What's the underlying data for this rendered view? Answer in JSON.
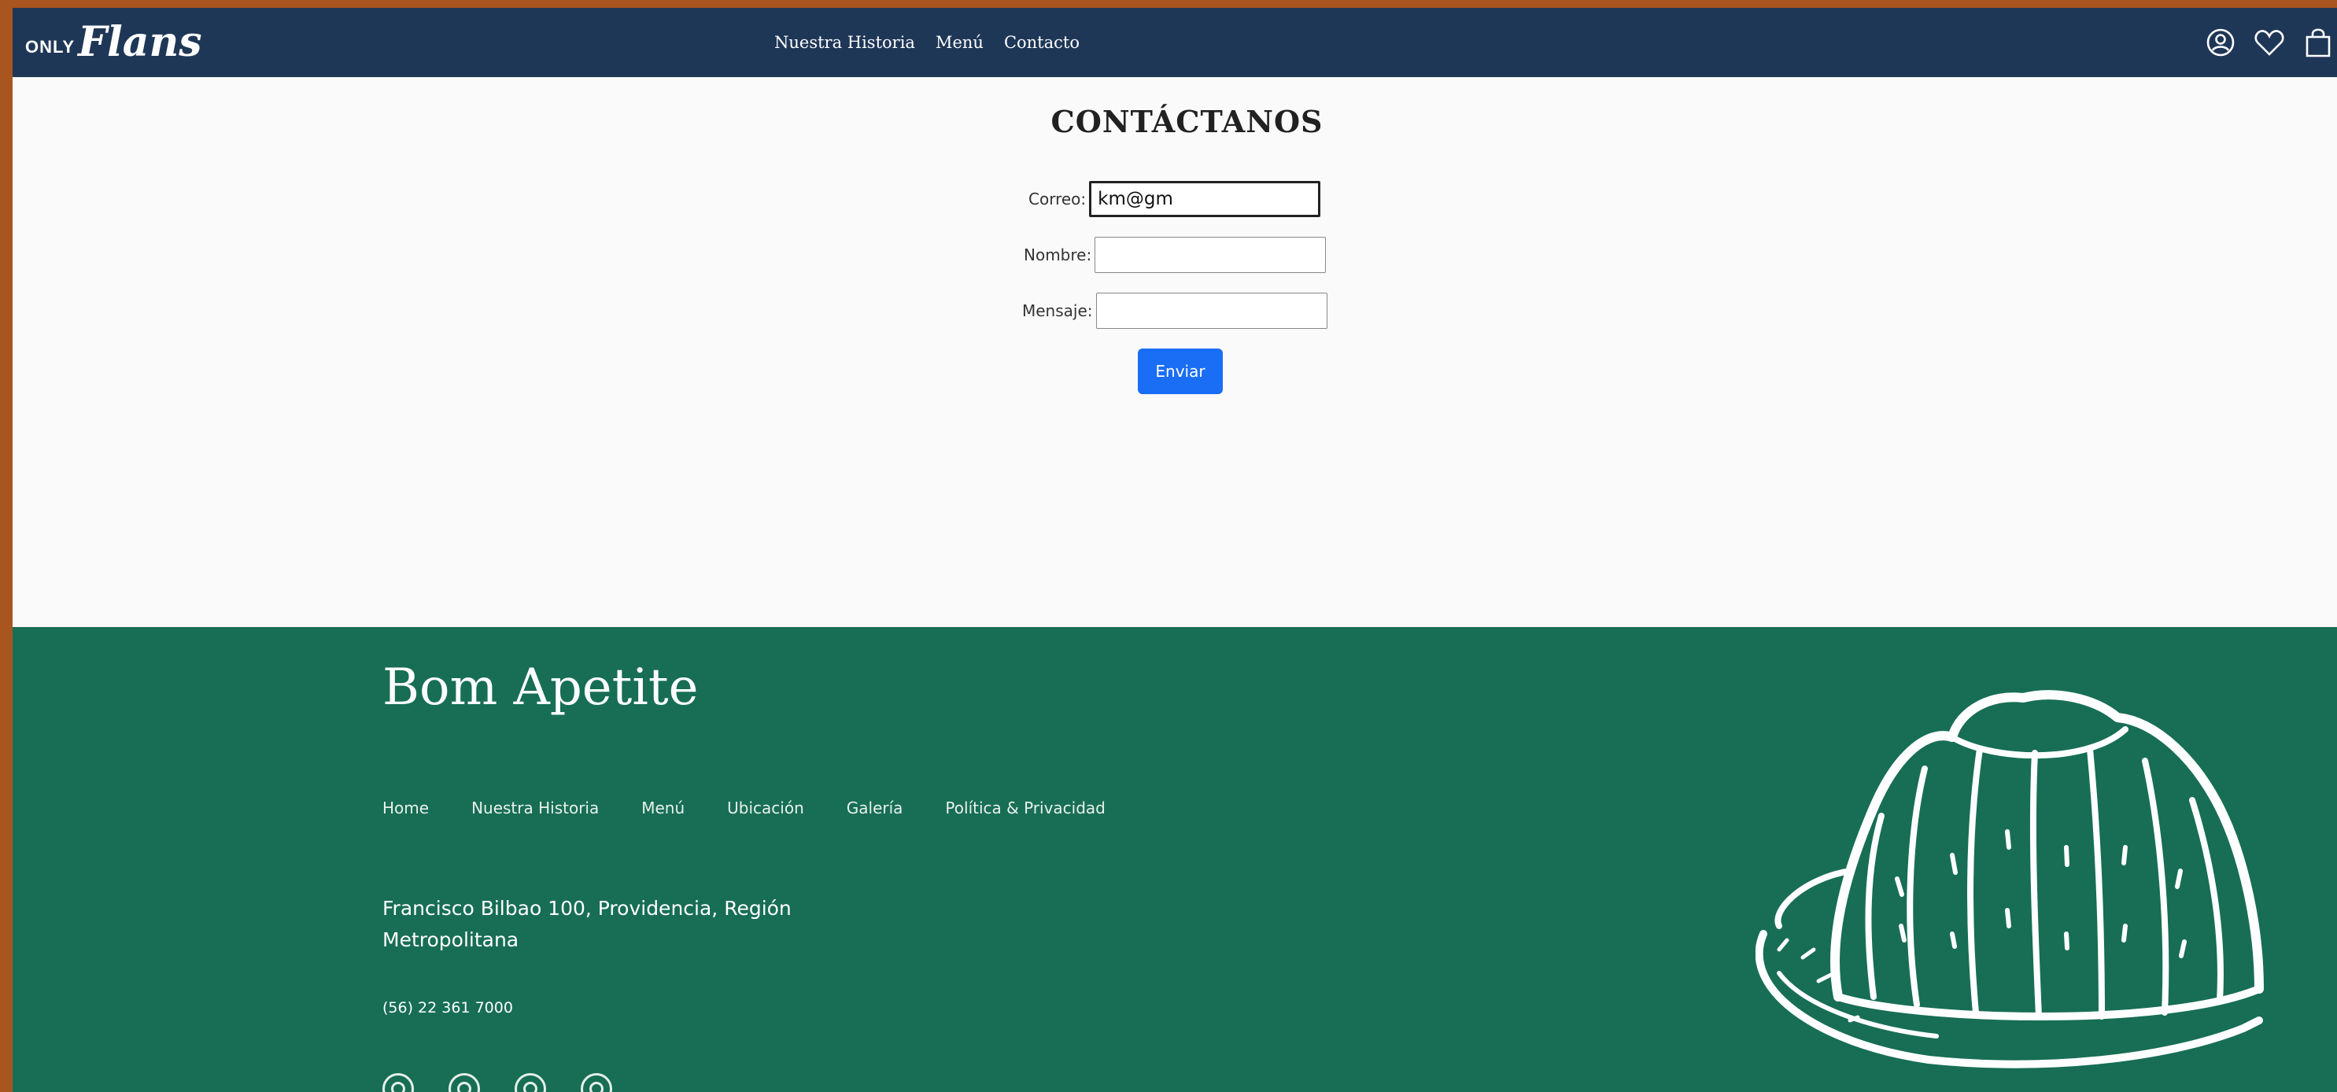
{
  "header": {
    "logo_small": "ONLY",
    "logo_script": "Flans",
    "nav": [
      "Nuestra Historia",
      "Menú",
      "Contacto"
    ],
    "icons": [
      "user-icon",
      "heart-icon",
      "shopping-bag-icon"
    ]
  },
  "contact": {
    "title": "CONTÁCTANOS",
    "email_label": "Correo:",
    "email_value": "km@gm",
    "name_label": "Nombre:",
    "name_value": "",
    "message_label": "Mensaje:",
    "message_value": "",
    "submit_label": "Enviar"
  },
  "footer": {
    "brand": "Bom Apetite",
    "links": [
      "Home",
      "Nuestra Historia",
      "Menú",
      "Ubicación",
      "Galería",
      "Política & Privacidad"
    ],
    "address": "Francisco Bilbao 100, Providencia, Región Metropolitana",
    "phone": "(56) 22 361 7000",
    "social_icons": [
      "instagram-icon",
      "twitter-icon",
      "whatsapp-icon",
      "pinterest-icon"
    ],
    "illustration": "flan-illustration"
  },
  "colors": {
    "navbar": "#1f3757",
    "footer": "#176e54",
    "button": "#1a6ef5",
    "page": "#fafafa",
    "outer": "#a9551f"
  }
}
